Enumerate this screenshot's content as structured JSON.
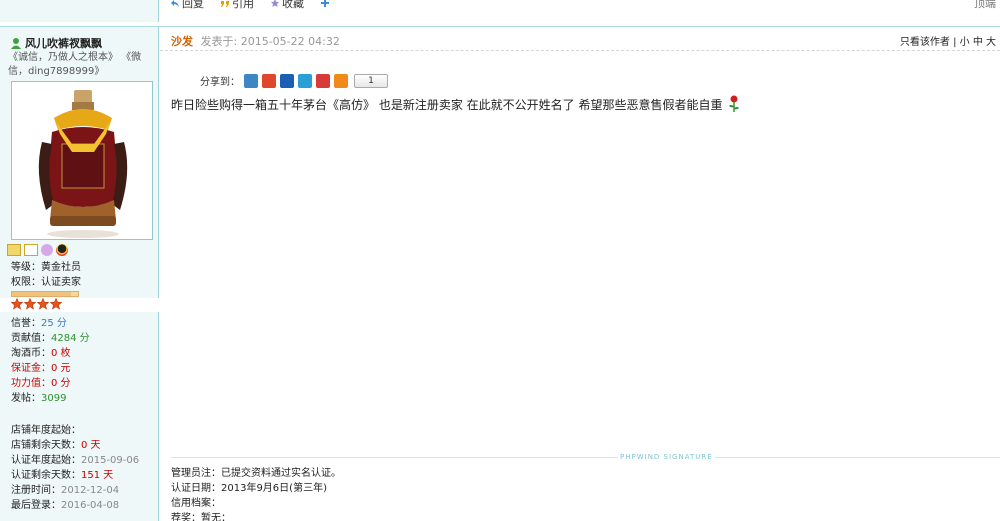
{
  "top": {
    "actions": [
      {
        "label": "回复",
        "icon": "reply-icon"
      },
      {
        "label": "引用",
        "icon": "quote-icon"
      },
      {
        "label": "收藏",
        "icon": "favorite-icon"
      }
    ],
    "right_text": "顶端"
  },
  "user": {
    "name": "风儿吹裤衩飘飘",
    "motto": "《诚信，乃做人之根本》 《微信，ding7898999》",
    "level_label": "等级：黄金社员",
    "role_label": "权限：认证卖家",
    "level_progress": 0.9,
    "stars": 4,
    "stats": [
      {
        "label": "信誉：",
        "value": "25 分",
        "style": "blue"
      },
      {
        "label": "贡献值：",
        "value": "4284 分",
        "style": "green"
      },
      {
        "label": "淘酒币：",
        "value": "0 枚",
        "style": "red"
      },
      {
        "label": "保证金：",
        "value": "0 元",
        "style": "red",
        "label_red": true
      },
      {
        "label": "功力值：",
        "value": "0 分",
        "style": "red",
        "label_red": true
      },
      {
        "label": "发帖：",
        "value": "3099",
        "style": "green"
      }
    ],
    "shop": [
      {
        "label": "店铺年度起始：",
        "value": "",
        "style": ""
      },
      {
        "label": "店铺剩余天数：",
        "value": "0 天",
        "style": "red"
      },
      {
        "label": "认证年度起始：",
        "value": "2015-09-06",
        "style": "gray"
      },
      {
        "label": "认证剩余天数：",
        "value": "151 天",
        "style": "red"
      },
      {
        "label": "注册时间：",
        "value": "2012-12-04",
        "style": "gray"
      },
      {
        "label": "最后登录：",
        "value": "2016-04-08",
        "style": "gray"
      }
    ]
  },
  "post": {
    "author": "沙发",
    "time": "发表于: 2015-05-22 04:32",
    "tools": {
      "only_author": "只看该作者",
      "sep": " | ",
      "small": "小",
      "medium": "中",
      "large": "大"
    },
    "share_label": "分享到：",
    "share_count": "1",
    "share_icons": [
      {
        "name": "qzone-share-icon",
        "color": "#3c86c6"
      },
      {
        "name": "weibo-share-icon",
        "color": "#e0462c"
      },
      {
        "name": "renren-share-icon",
        "color": "#1a5fb4"
      },
      {
        "name": "tencent-share-icon",
        "color": "#2a9fd6"
      },
      {
        "name": "pengyou-share-icon",
        "color": "#d83a3a"
      },
      {
        "name": "more-share-icon",
        "color": "#f08a1a"
      }
    ],
    "body": "昨日险些购得一箱五十年茅台《高仿》 也是新注册卖家 在此就不公开姓名了 希望那些恶意售假者能自重",
    "signature_label": "PHPWIND SIGNATURE",
    "admin_lines": [
      "管理员注：已提交资料通过实名认证。",
      "认证日期：2013年9月6日(第三年)",
      "信用档案：",
      "荐奖：暂无："
    ]
  }
}
